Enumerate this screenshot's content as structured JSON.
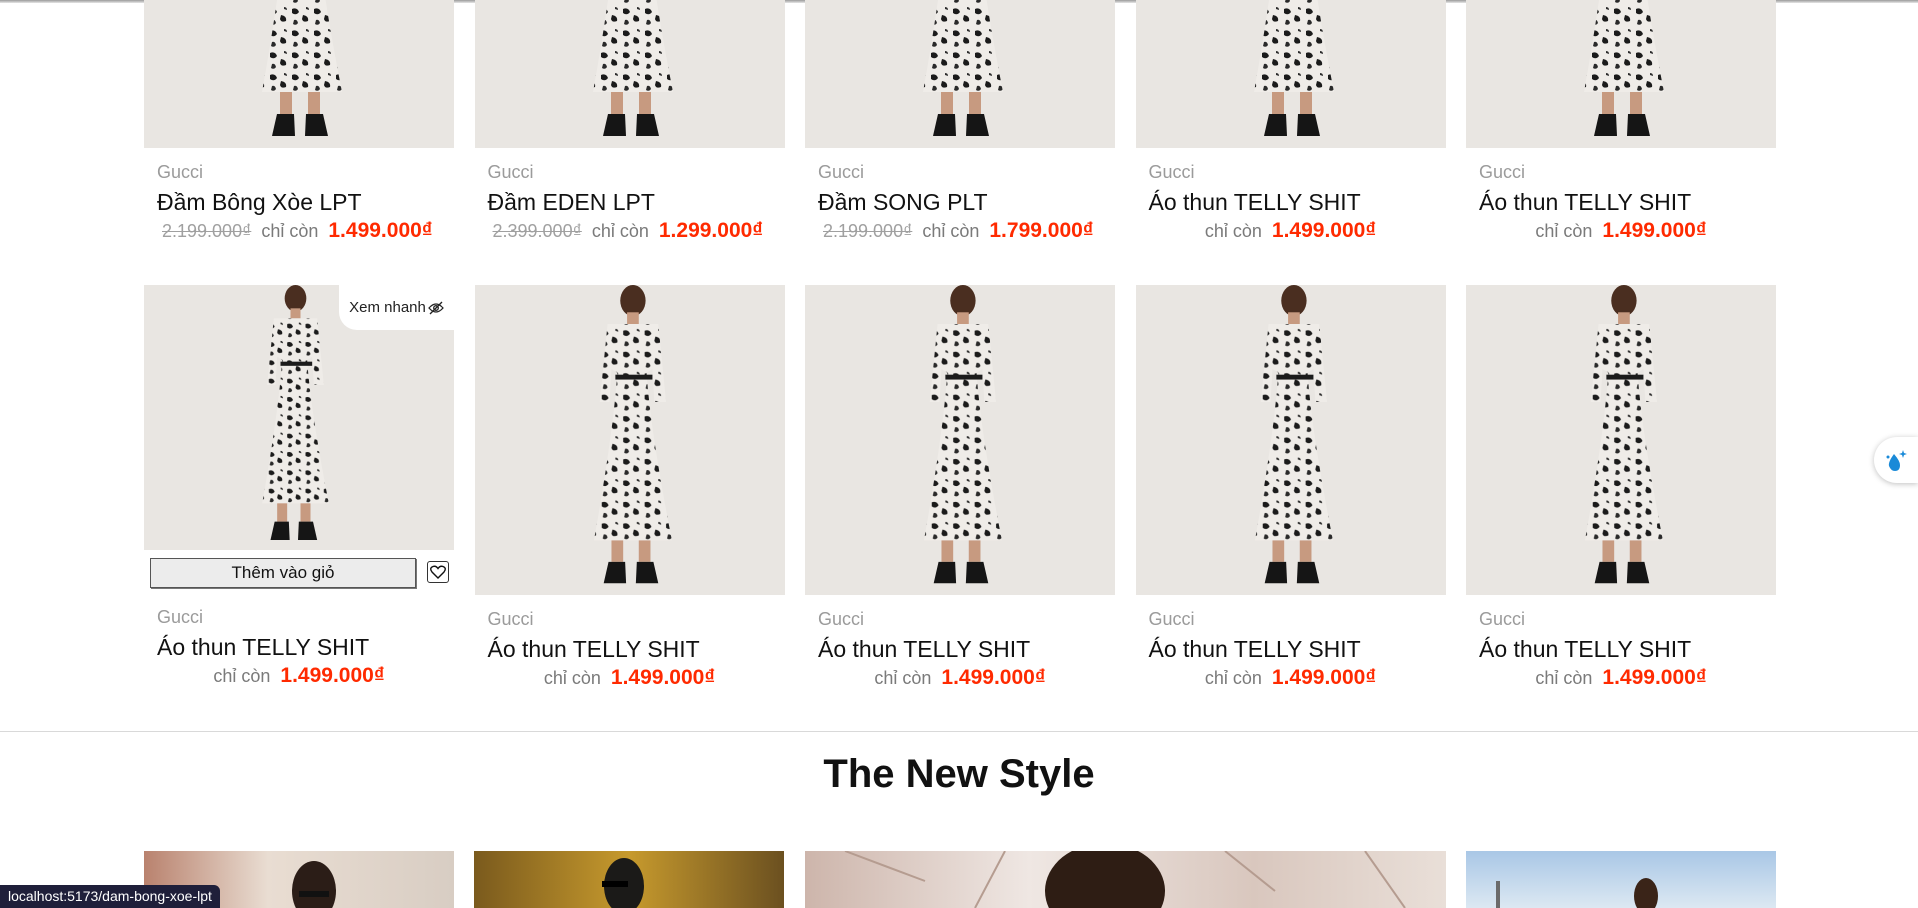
{
  "row1": [
    {
      "brand": "Gucci",
      "name": "Đầm Bông Xòe LPT",
      "old_price": "2.199.000₫",
      "only": "chỉ còn",
      "price": "1.499.000₫"
    },
    {
      "brand": "Gucci",
      "name": "Đầm EDEN LPT",
      "old_price": "2.399.000₫",
      "only": "chỉ còn",
      "price": "1.299.000₫"
    },
    {
      "brand": "Gucci",
      "name": "Đầm SONG PLT",
      "old_price": "2.199.000₫",
      "only": "chỉ còn",
      "price": "1.799.000₫"
    },
    {
      "brand": "Gucci",
      "name": "Áo thun TELLY SHIT",
      "only": "chỉ còn",
      "price": "1.499.000₫"
    },
    {
      "brand": "Gucci",
      "name": "Áo thun TELLY SHIT",
      "only": "chỉ còn",
      "price": "1.499.000₫"
    }
  ],
  "row2": [
    {
      "brand": "Gucci",
      "name": "Áo thun TELLY SHIT",
      "only": "chỉ còn",
      "price": "1.499.000₫",
      "quick_view": "Xem nhanh",
      "add_to_cart": "Thêm vào giỏ"
    },
    {
      "brand": "Gucci",
      "name": "Áo thun TELLY SHIT",
      "only": "chỉ còn",
      "price": "1.499.000₫"
    },
    {
      "brand": "Gucci",
      "name": "Áo thun TELLY SHIT",
      "only": "chỉ còn",
      "price": "1.499.000₫"
    },
    {
      "brand": "Gucci",
      "name": "Áo thun TELLY SHIT",
      "only": "chỉ còn",
      "price": "1.499.000₫"
    },
    {
      "brand": "Gucci",
      "name": "Áo thun TELLY SHIT",
      "only": "chỉ còn",
      "price": "1.499.000₫"
    }
  ],
  "section": {
    "title": "The New Style"
  },
  "status_bar": {
    "url": "localhost:5173/dam-bong-xoe-lpt"
  },
  "colors": {
    "sale_price": "#ff2a00",
    "old_price": "#a0a0a0",
    "brand": "#9b9b9b"
  },
  "icons": {
    "quick_view": "eye-slash-icon",
    "wishlist": "heart-outline-icon",
    "floating": "water-drop-sparkle-icon"
  }
}
